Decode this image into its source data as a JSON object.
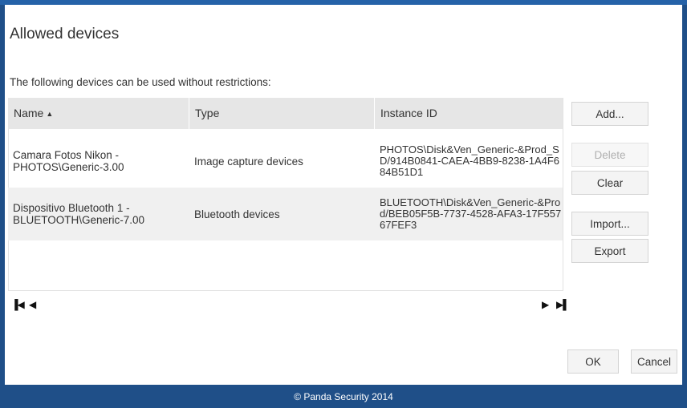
{
  "dialog": {
    "title": "Allowed devices",
    "subtitle": "The following devices can be used without restrictions:"
  },
  "table": {
    "columns": [
      {
        "label": "Name",
        "sort_indicator": "▲"
      },
      {
        "label": "Type"
      },
      {
        "label": "Instance ID"
      }
    ],
    "rows": [
      {
        "name": "Camara Fotos Nikon - PHOTOS\\Generic-3.00",
        "type": "Image capture devices",
        "instance_id": "PHOTOS\\Disk&Ven_Generic-&Prod_SD/914B0841-CAEA-4BB9-8238-1A4F684B51D1"
      },
      {
        "name": "Dispositivo Bluetooth 1 - BLUETOOTH\\Generic-7.00",
        "type": "Bluetooth devices",
        "instance_id": "BLUETOOTH\\Disk&Ven_Generic-&Prod/BEB05F5B-7737-4528-AFA3-17F55767FEF3"
      }
    ]
  },
  "side_buttons": {
    "add": "Add...",
    "delete": "Delete",
    "clear": "Clear",
    "import": "Import...",
    "export": "Export"
  },
  "pager": {
    "first_icon": "first-page-icon",
    "prev_icon": "previous-page-icon",
    "next_icon": "next-page-icon",
    "last_icon": "last-page-icon"
  },
  "actions": {
    "ok": "OK",
    "cancel": "Cancel"
  },
  "footer": {
    "text": "© Panda Security 2014"
  },
  "colors": {
    "frame": "#1f4f88",
    "header_bg": "#e6e6e6",
    "alt_row_bg": "#f0f0f0"
  }
}
